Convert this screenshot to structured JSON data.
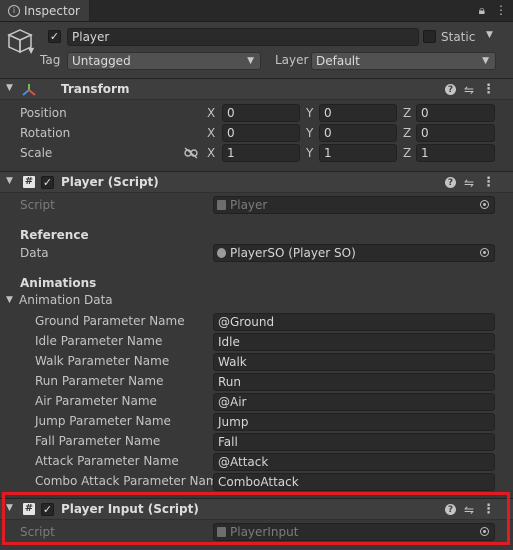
{
  "tab": {
    "title": "Inspector"
  },
  "header": {
    "object_name": "Player",
    "static_label": "Static",
    "tag_label": "Tag",
    "tag_value": "Untagged",
    "layer_label": "Layer",
    "layer_value": "Default"
  },
  "transform": {
    "title": "Transform",
    "rows": [
      {
        "label": "Position",
        "x": "0",
        "y": "0",
        "z": "0"
      },
      {
        "label": "Rotation",
        "x": "0",
        "y": "0",
        "z": "0"
      },
      {
        "label": "Scale",
        "x": "1",
        "y": "1",
        "z": "1"
      }
    ],
    "axes": [
      "X",
      "Y",
      "Z"
    ]
  },
  "player_script": {
    "title": "Player (Script)",
    "script_label": "Script",
    "script_value": "Player",
    "reference_header": "Reference",
    "data_label": "Data",
    "data_value": "PlayerSO (Player SO)",
    "animations_header": "Animations",
    "animation_data_label": "Animation Data",
    "params": [
      {
        "label": "Ground Parameter Name",
        "value": "@Ground"
      },
      {
        "label": "Idle Parameter Name",
        "value": "Idle"
      },
      {
        "label": "Walk Parameter Name",
        "value": "Walk"
      },
      {
        "label": "Run Parameter Name",
        "value": "Run"
      },
      {
        "label": "Air Parameter Name",
        "value": "@Air"
      },
      {
        "label": "Jump Parameter Name",
        "value": "Jump"
      },
      {
        "label": "Fall Parameter Name",
        "value": "Fall"
      },
      {
        "label": "Attack Parameter Name",
        "value": "@Attack"
      },
      {
        "label": "Combo Attack Parameter Name",
        "value": "ComboAttack"
      }
    ]
  },
  "player_input": {
    "title": "Player Input (Script)",
    "script_label": "Script",
    "script_value": "PlayerInput"
  },
  "colors": {
    "highlight": "#e21b23",
    "background": "#383838"
  }
}
